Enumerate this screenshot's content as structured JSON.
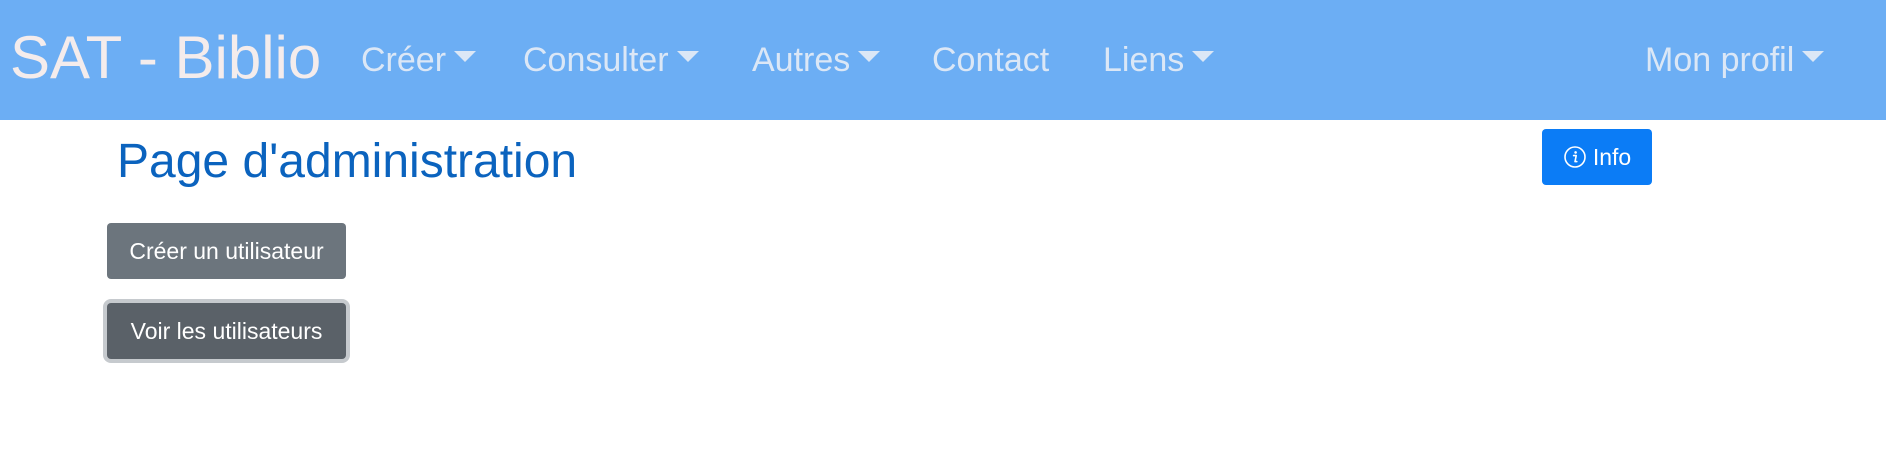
{
  "navbar": {
    "brand": "SAT - Biblio",
    "items": [
      {
        "label": "Créer",
        "dropdown": true
      },
      {
        "label": "Consulter",
        "dropdown": true
      },
      {
        "label": "Autres",
        "dropdown": true
      },
      {
        "label": "Contact",
        "dropdown": false
      },
      {
        "label": "Liens",
        "dropdown": true
      }
    ],
    "profile": {
      "label": "Mon profil",
      "dropdown": true
    }
  },
  "main": {
    "title": "Page d'administration",
    "info_button": {
      "label": "Info",
      "icon": "info-circle-icon"
    },
    "buttons": [
      {
        "label": "Créer un utilisateur"
      },
      {
        "label": "Voir les utilisateurs"
      }
    ]
  },
  "colors": {
    "navbar_bg": "#6caef4",
    "title": "#0b63be",
    "info_button": "#0b7cf6",
    "secondary_button": "#6c757d"
  }
}
